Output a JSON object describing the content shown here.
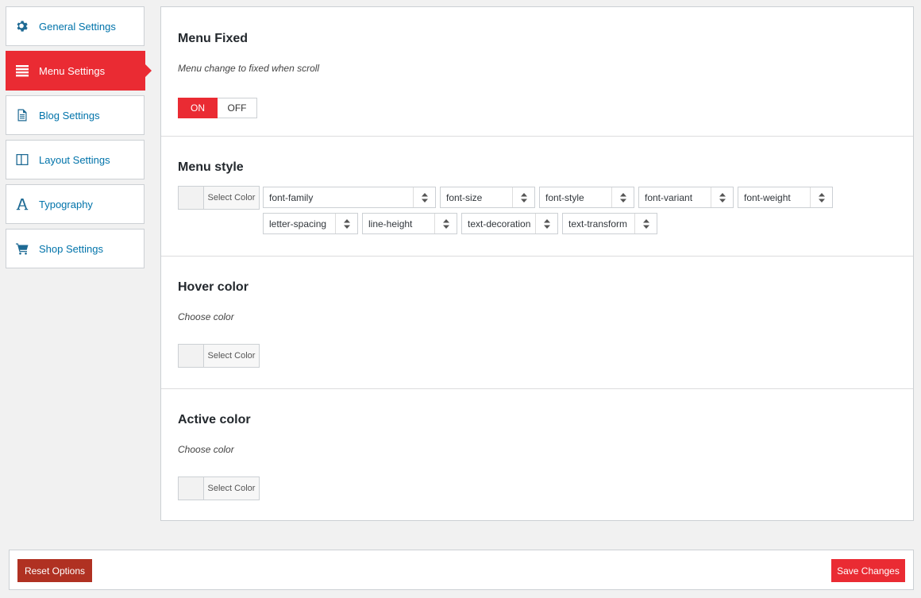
{
  "sidebar": {
    "items": [
      {
        "label": "General Settings",
        "icon": "gear-icon"
      },
      {
        "label": "Menu Settings",
        "icon": "menu-lines-icon",
        "active": true
      },
      {
        "label": "Blog Settings",
        "icon": "document-icon"
      },
      {
        "label": "Layout Settings",
        "icon": "layout-columns-icon"
      },
      {
        "label": "Typography",
        "icon": "letter-a-icon"
      },
      {
        "label": "Shop Settings",
        "icon": "cart-icon"
      }
    ]
  },
  "sections": {
    "menu_fixed": {
      "title": "Menu Fixed",
      "description": "Menu change to fixed when scroll",
      "toggle_on": "ON",
      "toggle_off": "OFF"
    },
    "menu_style": {
      "title": "Menu style",
      "color_label": "Select Color",
      "selects_row1": [
        "font-family",
        "font-size",
        "font-style",
        "font-variant",
        "font-weight"
      ],
      "selects_row2": [
        "letter-spacing",
        "line-height",
        "text-decoration",
        "text-transform"
      ]
    },
    "hover_color": {
      "title": "Hover color",
      "description": "Choose color",
      "color_label": "Select Color"
    },
    "active_color": {
      "title": "Active color",
      "description": "Choose color",
      "color_label": "Select Color"
    }
  },
  "footer": {
    "reset_label": "Reset Options",
    "save_label": "Save Changes"
  },
  "colors": {
    "accent": "#ea2b33",
    "reset": "#b03122",
    "link": "#0073aa"
  }
}
